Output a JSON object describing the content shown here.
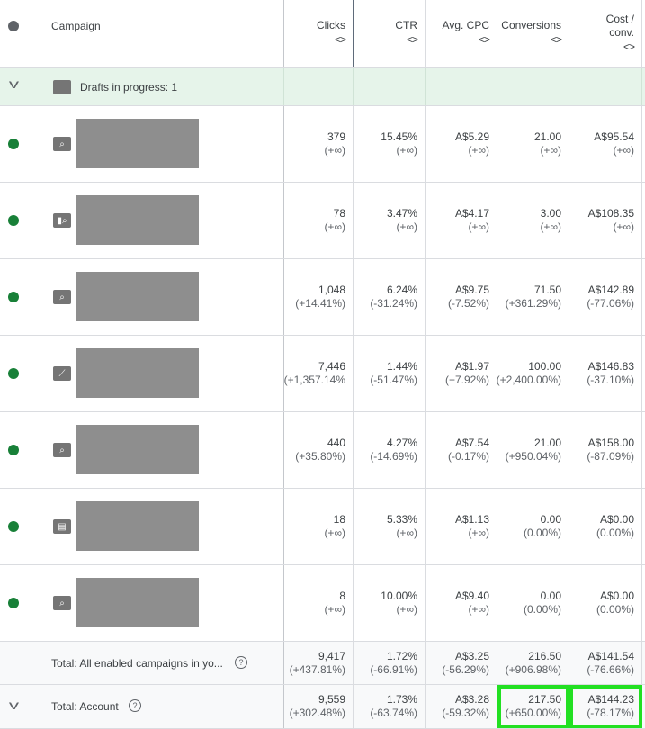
{
  "header": {
    "campaign": "Campaign",
    "columns": [
      "Clicks",
      "CTR",
      "Avg. CPC",
      "Conversions",
      "Cost / conv."
    ],
    "sort_icon": "<>"
  },
  "drafts": {
    "label": "Drafts in progress: 1"
  },
  "rows": [
    {
      "icon": "search",
      "clicks": [
        "379",
        "(+∞)"
      ],
      "ctr": [
        "15.45%",
        "(+∞)"
      ],
      "cpc": [
        "A$5.29",
        "(+∞)"
      ],
      "conv": [
        "21.00",
        "(+∞)"
      ],
      "cost": [
        "A$95.54",
        "(+∞)"
      ]
    },
    {
      "icon": "display-search",
      "clicks": [
        "78",
        "(+∞)"
      ],
      "ctr": [
        "3.47%",
        "(+∞)"
      ],
      "cpc": [
        "A$4.17",
        "(+∞)"
      ],
      "conv": [
        "3.00",
        "(+∞)"
      ],
      "cost": [
        "A$108.35",
        "(+∞)"
      ]
    },
    {
      "icon": "search",
      "clicks": [
        "1,048",
        "(+14.41%)"
      ],
      "ctr": [
        "6.24%",
        "(-31.24%)"
      ],
      "cpc": [
        "A$9.75",
        "(-7.52%)"
      ],
      "conv": [
        "71.50",
        "(+361.29%)"
      ],
      "cost": [
        "A$142.89",
        "(-77.06%)"
      ]
    },
    {
      "icon": "performance-max",
      "clicks": [
        "7,446",
        "(+1,357.14%"
      ],
      "ctr": [
        "1.44%",
        "(-51.47%)"
      ],
      "cpc": [
        "A$1.97",
        "(+7.92%)"
      ],
      "conv": [
        "100.00",
        "(+2,400.00%)"
      ],
      "cost": [
        "A$146.83",
        "(-37.10%)"
      ]
    },
    {
      "icon": "search",
      "clicks": [
        "440",
        "(+35.80%)"
      ],
      "ctr": [
        "4.27%",
        "(-14.69%)"
      ],
      "cpc": [
        "A$7.54",
        "(-0.17%)"
      ],
      "conv": [
        "21.00",
        "(+950.04%)"
      ],
      "cost": [
        "A$158.00",
        "(-87.09%)"
      ]
    },
    {
      "icon": "display",
      "clicks": [
        "18",
        "(+∞)"
      ],
      "ctr": [
        "5.33%",
        "(+∞)"
      ],
      "cpc": [
        "A$1.13",
        "(+∞)"
      ],
      "conv": [
        "0.00",
        "(0.00%)"
      ],
      "cost": [
        "A$0.00",
        "(0.00%)"
      ]
    },
    {
      "icon": "search",
      "clicks": [
        "8",
        "(+∞)"
      ],
      "ctr": [
        "10.00%",
        "(+∞)"
      ],
      "cpc": [
        "A$9.40",
        "(+∞)"
      ],
      "conv": [
        "0.00",
        "(0.00%)"
      ],
      "cost": [
        "A$0.00",
        "(0.00%)"
      ]
    }
  ],
  "total_enabled": {
    "label": "Total: All enabled campaigns in yo...",
    "clicks": [
      "9,417",
      "(+437.81%)"
    ],
    "ctr": [
      "1.72%",
      "(-66.91%)"
    ],
    "cpc": [
      "A$3.25",
      "(-56.29%)"
    ],
    "conv": [
      "216.50",
      "(+906.98%)"
    ],
    "cost": [
      "A$141.54",
      "(-76.66%)"
    ]
  },
  "total_account": {
    "label": "Total: Account",
    "clicks": [
      "9,559",
      "(+302.48%)"
    ],
    "ctr": [
      "1.73%",
      "(-63.74%)"
    ],
    "cpc": [
      "A$3.28",
      "(-59.32%)"
    ],
    "conv": [
      "217.50",
      "(+650.00%)"
    ],
    "cost": [
      "A$144.23",
      "(-78.17%)"
    ]
  },
  "colors": {
    "enabled": "#188038",
    "highlight": "#22e022",
    "drafts_bg": "#e6f4ea"
  }
}
